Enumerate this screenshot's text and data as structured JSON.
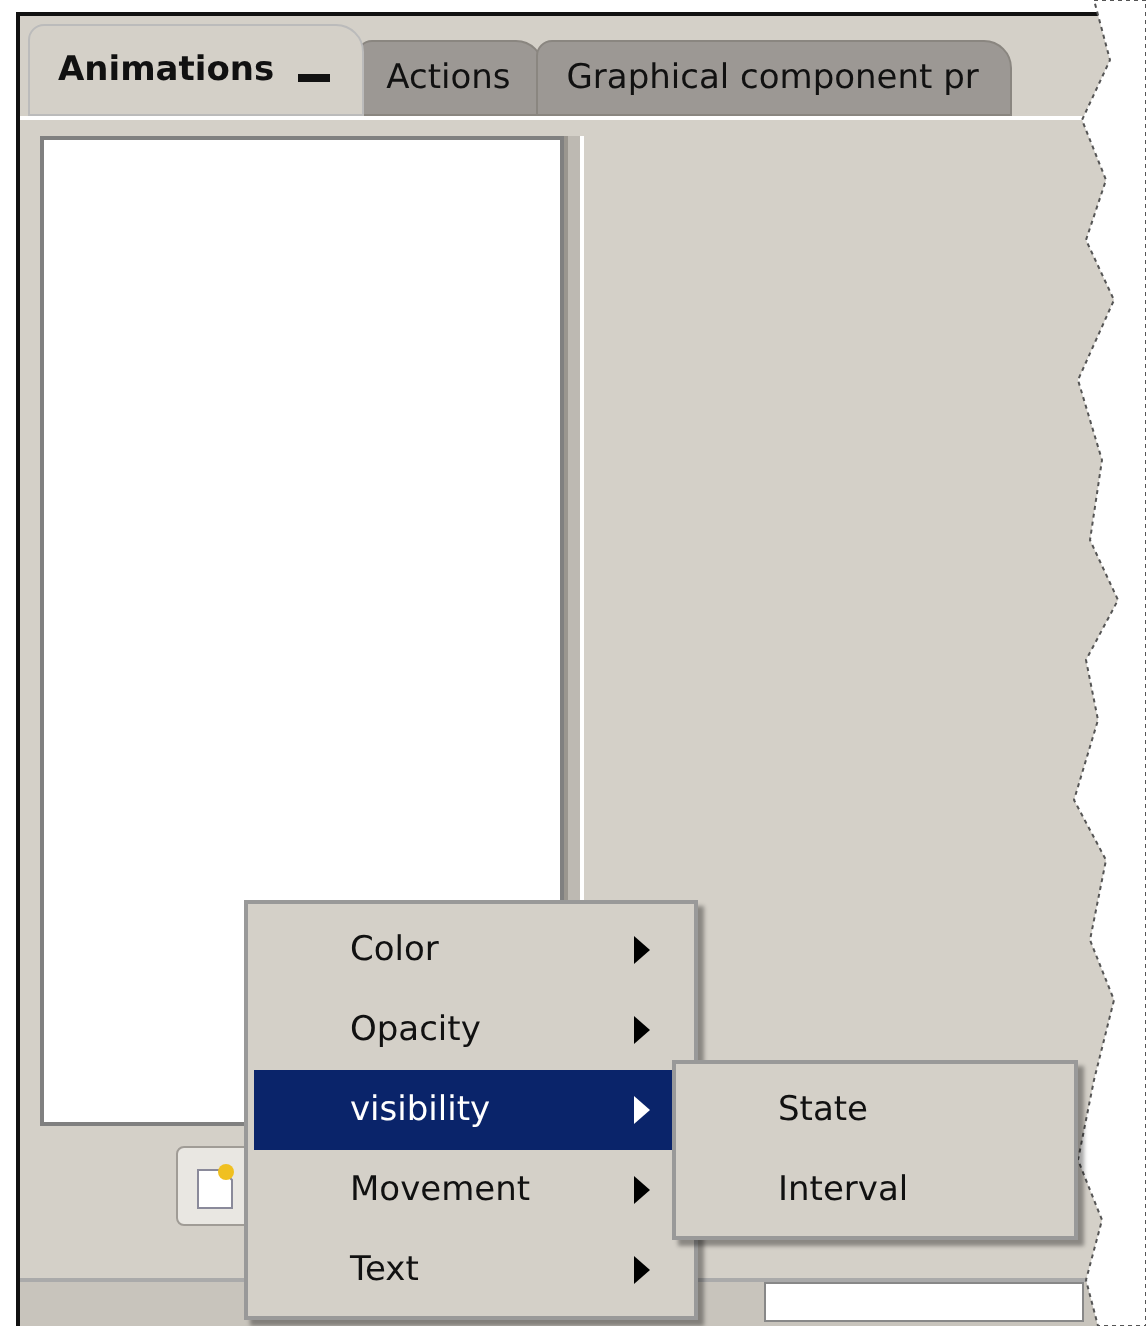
{
  "tabs": [
    {
      "label": "Animations",
      "selected": true,
      "minimizable": true
    },
    {
      "label": "Actions",
      "selected": false,
      "minimizable": false
    },
    {
      "label": "Graphical component pr",
      "selected": false,
      "minimizable": false
    }
  ],
  "context_menu": {
    "items": [
      {
        "label": "Color",
        "selected": false,
        "submenu": true
      },
      {
        "label": "Opacity",
        "selected": false,
        "submenu": true
      },
      {
        "label": "visibility",
        "selected": true,
        "submenu": true
      },
      {
        "label": "Movement",
        "selected": false,
        "submenu": true
      },
      {
        "label": "Text",
        "selected": false,
        "submenu": true
      }
    ]
  },
  "submenu": {
    "items": [
      {
        "label": "State"
      },
      {
        "label": "Interval"
      }
    ]
  }
}
